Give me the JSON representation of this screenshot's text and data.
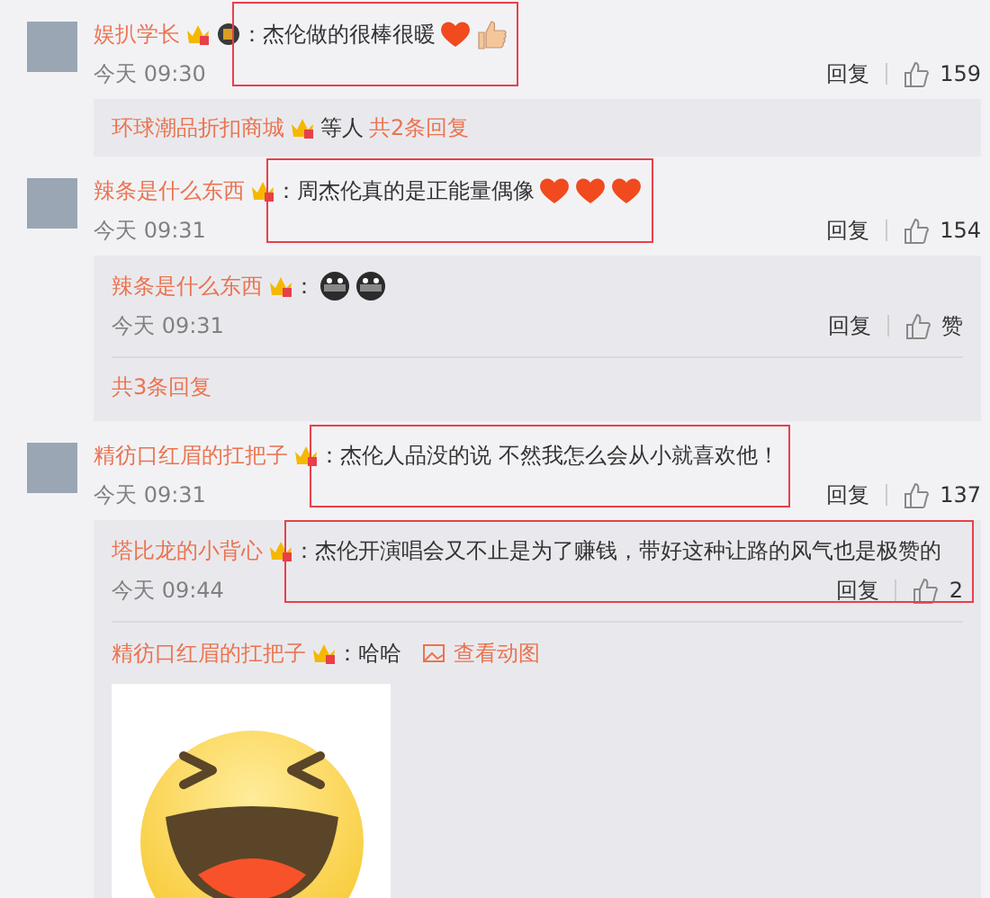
{
  "feed": [
    {
      "kind": "comment",
      "user": "娱扒学长",
      "badges": [
        {
          "kind": "crown"
        },
        {
          "kind": "medal"
        }
      ],
      "text": "：杰伦做的很棒很暖",
      "emoticons": [
        {
          "kind": "heart"
        },
        {
          "kind": "thumbs_up"
        }
      ],
      "highlighted": true,
      "time": "今天 09:30",
      "reply": "回复",
      "likes": "159"
    },
    {
      "kind": "summary",
      "user": "环球潮品折扣商城",
      "badges": [
        {
          "kind": "crown"
        }
      ],
      "suffix": "等人",
      "more": "共2条回复"
    },
    {
      "kind": "comment",
      "user": "辣条是什么东西",
      "badges": [
        {
          "kind": "crown"
        }
      ],
      "text": "：周杰伦真的是正能量偶像",
      "emoticons": [
        {
          "kind": "heart"
        },
        {
          "kind": "heart"
        },
        {
          "kind": "heart"
        }
      ],
      "highlighted": true,
      "time": "今天 09:31",
      "reply": "回复",
      "likes": "154"
    },
    {
      "kind": "replies",
      "items": [
        {
          "user": "辣条是什么东西",
          "badges": [
            {
              "kind": "crown"
            }
          ],
          "text": "：",
          "emoticons": [
            {
              "kind": "mask"
            },
            {
              "kind": "mask"
            }
          ],
          "highlighted": false,
          "time": "今天 09:31",
          "reply": "回复",
          "likes": "赞"
        }
      ],
      "more": "共3条回复"
    },
    {
      "kind": "comment",
      "user": "精彷口红眉的扛把子",
      "badges": [
        {
          "kind": "crown"
        }
      ],
      "text": "：杰伦人品没的说 不然我怎么会从小就喜欢他！",
      "highlighted": true,
      "time": "今天 09:31",
      "reply": "回复",
      "likes": "137"
    },
    {
      "kind": "replies",
      "items": [
        {
          "user": "塔比龙的小背心",
          "badges": [
            {
              "kind": "crown"
            }
          ],
          "text": "：杰伦开演唱会又不止是为了赚钱，带好这种让路的风气也是极赞的",
          "highlighted": true,
          "time": "今天 09:44",
          "reply": "回复",
          "likes": "2"
        },
        {
          "user": "精彷口红眉的扛把子",
          "badges": [
            {
              "kind": "crown"
            }
          ],
          "text": "：哈哈",
          "highlighted": false,
          "gif_link": "查看动图",
          "gif": true
        }
      ]
    }
  ]
}
